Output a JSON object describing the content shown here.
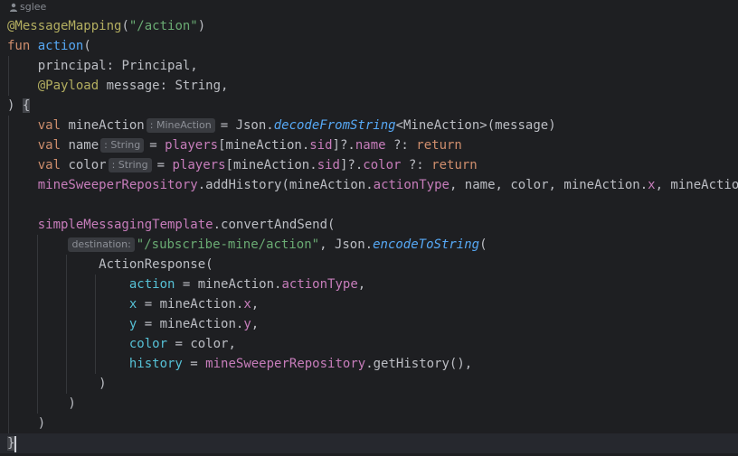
{
  "author": {
    "icon": "user-icon",
    "name": "sglee"
  },
  "code": {
    "annotation": "@MessageMapping",
    "mapping_path": "\"/action\"",
    "kw_fun": "fun",
    "fn_name": "action",
    "param_principal_name": "principal",
    "principal_type": "Principal",
    "payload_annotation": "@Payload",
    "param_message_name": "message",
    "string_type": "String",
    "kw_val": "val",
    "var_mine_action": "mineAction",
    "hint_mine_action": ": MineAction",
    "json": "Json",
    "decode_fn": "decodeFromString",
    "mine_action_type": "<MineAction>",
    "message_arg": "message",
    "var_name": "name",
    "hint_string": ": String",
    "players": "players",
    "sid": "sid",
    "name_prop": "name",
    "kw_return": "return",
    "var_color": "color",
    "color_prop": "color",
    "repo": "mineSweeperRepository",
    "add_history": "addHistory",
    "action_type": "actionType",
    "x_prop": "x",
    "y_prop": "y",
    "template": "simpleMessagingTemplate",
    "convert_fn": "convertAndSend",
    "hint_destination": "destination:",
    "destination": "\"/subscribe-mine/action\"",
    "encode_fn": "encodeToString",
    "action_response": "ActionResponse",
    "named_action": "action",
    "named_x": "x",
    "named_y": "y",
    "named_color": "color",
    "named_history": "history",
    "get_history": "getHistory"
  }
}
